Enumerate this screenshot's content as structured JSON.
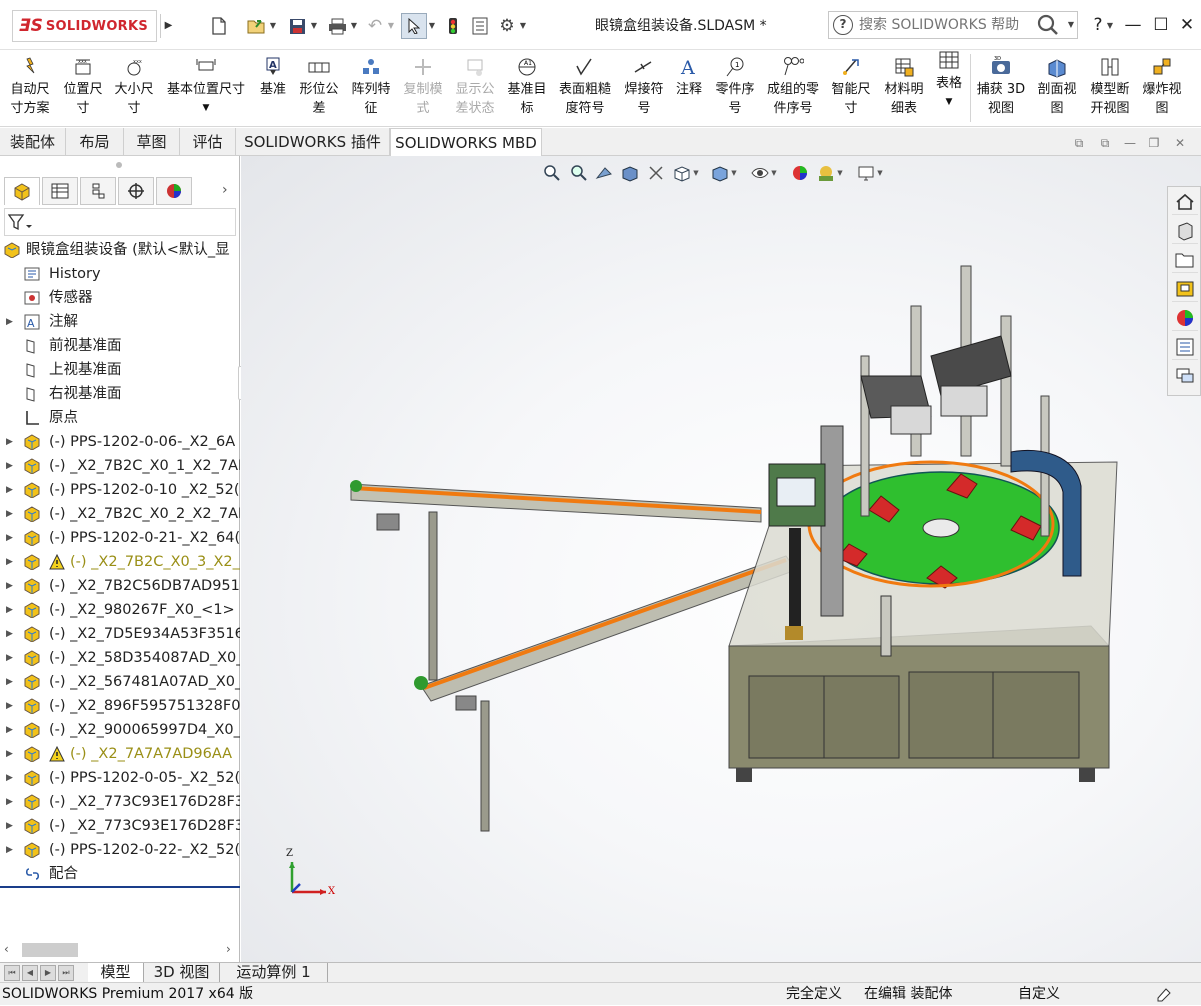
{
  "app": {
    "brand": "SOLIDWORKS",
    "brand_ds": "ƎS",
    "document_title": "眼镜盒组装设备.SLDASM *"
  },
  "search": {
    "placeholder": "搜索 SOLIDWORKS 帮助"
  },
  "window_controls": {
    "help": "?",
    "minimize": "—",
    "maximize": "☐",
    "close": "✕"
  },
  "ribbon": {
    "items": [
      {
        "label1": "自动尺",
        "label2": "寸方案",
        "icon": "auto-dimension-icon",
        "enabled": true
      },
      {
        "label1": "位置尺",
        "label2": "寸",
        "icon": "location-dimension-icon",
        "enabled": true
      },
      {
        "label1": "大小尺",
        "label2": "寸",
        "icon": "size-dimension-icon",
        "enabled": true
      },
      {
        "label1": "基本位置尺寸",
        "label2": "",
        "icon": "basic-location-dimension-icon",
        "enabled": true
      },
      {
        "label1": "基准",
        "label2": "",
        "icon": "datum-icon",
        "enabled": true
      },
      {
        "label1": "形位公",
        "label2": "差",
        "icon": "geometric-tolerance-icon",
        "enabled": true
      },
      {
        "label1": "阵列特",
        "label2": "征",
        "icon": "pattern-feature-icon",
        "enabled": true
      },
      {
        "label1": "复制模",
        "label2": "式",
        "icon": "copy-scheme-icon",
        "enabled": false
      },
      {
        "label1": "显示公",
        "label2": "差状态",
        "icon": "tolerance-status-icon",
        "enabled": false
      },
      {
        "label1": "基准目",
        "label2": "标",
        "icon": "datum-target-icon",
        "enabled": true
      },
      {
        "label1": "表面粗糙",
        "label2": "度符号",
        "icon": "surface-finish-icon",
        "enabled": true
      },
      {
        "label1": "焊接符",
        "label2": "号",
        "icon": "weld-symbol-icon",
        "enabled": true
      },
      {
        "label1": "注释",
        "label2": "",
        "icon": "note-icon",
        "enabled": true
      },
      {
        "label1": "零件序",
        "label2": "号",
        "icon": "balloon-icon",
        "enabled": true
      },
      {
        "label1": "成组的零",
        "label2": "件序号",
        "icon": "stacked-balloon-icon",
        "enabled": true
      },
      {
        "label1": "智能尺",
        "label2": "寸",
        "icon": "smart-dimension-icon",
        "enabled": true
      },
      {
        "label1": "材料明",
        "label2": "细表",
        "icon": "bom-icon",
        "enabled": true
      },
      {
        "label1": "表格",
        "label2": "",
        "icon": "table-icon",
        "enabled": true
      },
      {
        "label1": "捕获 3D",
        "label2": "视图",
        "icon": "capture-3d-view-icon",
        "enabled": true
      },
      {
        "label1": "剖面视",
        "label2": "图",
        "icon": "section-view-icon",
        "enabled": true
      },
      {
        "label1": "模型断",
        "label2": "开视图",
        "icon": "model-break-view-icon",
        "enabled": true
      },
      {
        "label1": "爆炸视",
        "label2": "图",
        "icon": "exploded-view-icon",
        "enabled": true
      }
    ]
  },
  "command_tabs": [
    "装配体",
    "布局",
    "草图",
    "评估",
    "SOLIDWORKS 插件",
    "SOLIDWORKS MBD"
  ],
  "tree": {
    "root": "眼镜盒组装设备 (默认<默认_显",
    "items": [
      {
        "text": "History",
        "icon": "history-icon",
        "arrow": false,
        "warn": false
      },
      {
        "text": "传感器",
        "icon": "sensor-icon",
        "arrow": false,
        "warn": false
      },
      {
        "text": "注解",
        "icon": "annotation-icon",
        "arrow": true,
        "warn": false
      },
      {
        "text": "前视基准面",
        "icon": "plane-icon",
        "arrow": false,
        "warn": false
      },
      {
        "text": "上视基准面",
        "icon": "plane-icon",
        "arrow": false,
        "warn": false
      },
      {
        "text": "右视基准面",
        "icon": "plane-icon",
        "arrow": false,
        "warn": false
      },
      {
        "text": "原点",
        "icon": "origin-icon",
        "arrow": false,
        "warn": false
      },
      {
        "text": "(-) PPS-1202-0-06-_X2_6A",
        "icon": "assembly-icon",
        "arrow": true,
        "warn": false
      },
      {
        "text": "(-) _X2_7B2C_X0_1_X2_7AI",
        "icon": "assembly-icon",
        "arrow": true,
        "warn": false
      },
      {
        "text": "(-) PPS-1202-0-10 _X2_52(",
        "icon": "assembly-icon",
        "arrow": true,
        "warn": false
      },
      {
        "text": "(-) _X2_7B2C_X0_2_X2_7AI",
        "icon": "assembly-icon",
        "arrow": true,
        "warn": false
      },
      {
        "text": "(-) PPS-1202-0-21-_X2_64(",
        "icon": "assembly-icon",
        "arrow": true,
        "warn": false
      },
      {
        "text": "(-) _X2_7B2C_X0_3_X2_",
        "icon": "assembly-icon",
        "arrow": true,
        "warn": true
      },
      {
        "text": "(-) _X2_7B2C56DB7AD951(",
        "icon": "assembly-icon",
        "arrow": true,
        "warn": false
      },
      {
        "text": "(-) _X2_980267F_X0_<1> (",
        "icon": "assembly-icon",
        "arrow": true,
        "warn": false
      },
      {
        "text": "(-) _X2_7D5E934A53F3516",
        "icon": "assembly-icon",
        "arrow": true,
        "warn": false
      },
      {
        "text": "(-) _X2_58D354087AD_X0_",
        "icon": "assembly-icon",
        "arrow": true,
        "warn": false
      },
      {
        "text": "(-) _X2_567481A07AD_X0_",
        "icon": "assembly-icon",
        "arrow": true,
        "warn": false
      },
      {
        "text": "(-) _X2_896F595751328F0!",
        "icon": "assembly-icon",
        "arrow": true,
        "warn": false
      },
      {
        "text": "(-) _X2_900065997D4_X0_",
        "icon": "assembly-icon",
        "arrow": true,
        "warn": false
      },
      {
        "text": "(-) _X2_7A7A7AD96AA",
        "icon": "assembly-icon",
        "arrow": true,
        "warn": true
      },
      {
        "text": "(-) PPS-1202-0-05-_X2_52(",
        "icon": "assembly-icon",
        "arrow": true,
        "warn": false
      },
      {
        "text": "(-) _X2_773C93E176D28F3",
        "icon": "assembly-icon",
        "arrow": true,
        "warn": false
      },
      {
        "text": "(-) _X2_773C93E176D28F3",
        "icon": "assembly-icon",
        "arrow": true,
        "warn": false
      },
      {
        "text": "(-) PPS-1202-0-22-_X2_52(",
        "icon": "assembly-icon",
        "arrow": true,
        "warn": false
      },
      {
        "text": "配合",
        "icon": "mates-icon",
        "arrow": false,
        "warn": false
      }
    ]
  },
  "triad": {
    "z": "Z",
    "x": "X"
  },
  "bottom_tabs": [
    "模型",
    "3D 视图",
    "运动算例 1"
  ],
  "status": {
    "product": "SOLIDWORKS Premium 2017 x64 版",
    "definition": "完全定义",
    "editing": "在编辑 装配体",
    "units": "自定义",
    "icon": "rebuild-icon"
  },
  "colors": {
    "brand_red": "#d0262e",
    "turntable_green": "#2fbf2f",
    "highlight_orange": "#f07a10",
    "frame_gray": "#a9a68c",
    "cabinet": "#8a8a6e",
    "warn_text": "#9a8f16"
  }
}
